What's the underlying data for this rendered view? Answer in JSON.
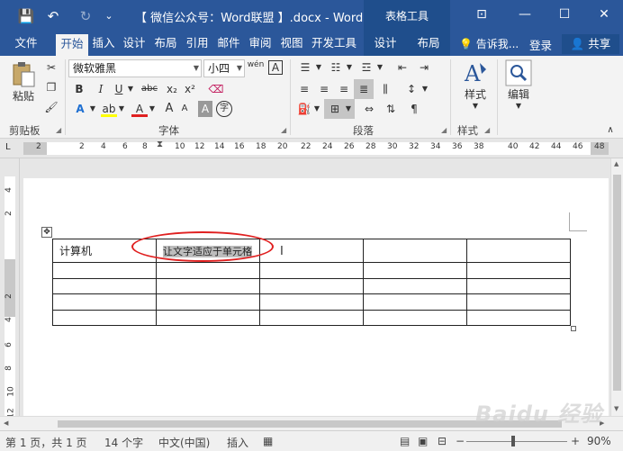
{
  "title_bar": {
    "doc_title": "【 微信公众号：Word联盟 】.docx - Word",
    "context_group": "表格工具",
    "save_glyph": "💾",
    "undo_glyph": "↶",
    "redo_glyph": "↻",
    "qa_more_glyph": "⌄",
    "ribbon_opts_glyph": "⊡",
    "min_glyph": "—",
    "max_glyph": "☐",
    "close_glyph": "✕"
  },
  "tabs": [
    {
      "label": "文件"
    },
    {
      "label": "开始"
    },
    {
      "label": "插入"
    },
    {
      "label": "设计"
    },
    {
      "label": "布局"
    },
    {
      "label": "引用"
    },
    {
      "label": "邮件"
    },
    {
      "label": "审阅"
    },
    {
      "label": "视图"
    },
    {
      "label": "开发工具"
    },
    {
      "label": "设计"
    },
    {
      "label": "布局"
    }
  ],
  "tell_me": "告诉我...",
  "login": "登录",
  "share": "共享",
  "ribbon": {
    "clipboard": {
      "label": "剪贴板",
      "paste": "粘贴"
    },
    "font": {
      "label": "字体",
      "font_name": "微软雅黑",
      "font_size": "小四",
      "bold": "B",
      "italic": "I",
      "underline": "U",
      "strike": "abc",
      "sub": "x₂",
      "sup": "x²",
      "grow": "A",
      "shrink": "A",
      "phonetic": "wén",
      "char_border": "A",
      "text_effect": "A",
      "highlight": "ab",
      "font_color": "A",
      "shade": "A",
      "enclose": "字"
    },
    "paragraph": {
      "label": "段落"
    },
    "styles": {
      "label": "样式",
      "button": "样式"
    },
    "editing": {
      "button": "编辑"
    }
  },
  "ruler_numbers": [
    "2",
    "2",
    "4",
    "6",
    "8",
    "10",
    "12",
    "14",
    "16",
    "18",
    "20",
    "22",
    "24",
    "26",
    "28",
    "30",
    "32",
    "34",
    "36",
    "38",
    "40",
    "42",
    "44",
    "46",
    "48"
  ],
  "vruler_numbers": [
    "4",
    "2",
    "2",
    "4",
    "6",
    "8",
    "10",
    "12"
  ],
  "table": {
    "rows": [
      [
        "计算机",
        "让文字适应于单元格",
        "",
        "",
        ""
      ],
      [
        "",
        "",
        "",
        "",
        ""
      ],
      [
        "",
        "",
        "",
        "",
        ""
      ],
      [
        "",
        "",
        "",
        "",
        ""
      ],
      [
        "",
        "",
        "",
        "",
        ""
      ]
    ]
  },
  "status": {
    "page": "第 1 页，共 1 页",
    "words": "14 个字",
    "lang": "中文(中国)",
    "mode": "插入",
    "zoom": "90%"
  },
  "watermark": "Baidu 经验"
}
